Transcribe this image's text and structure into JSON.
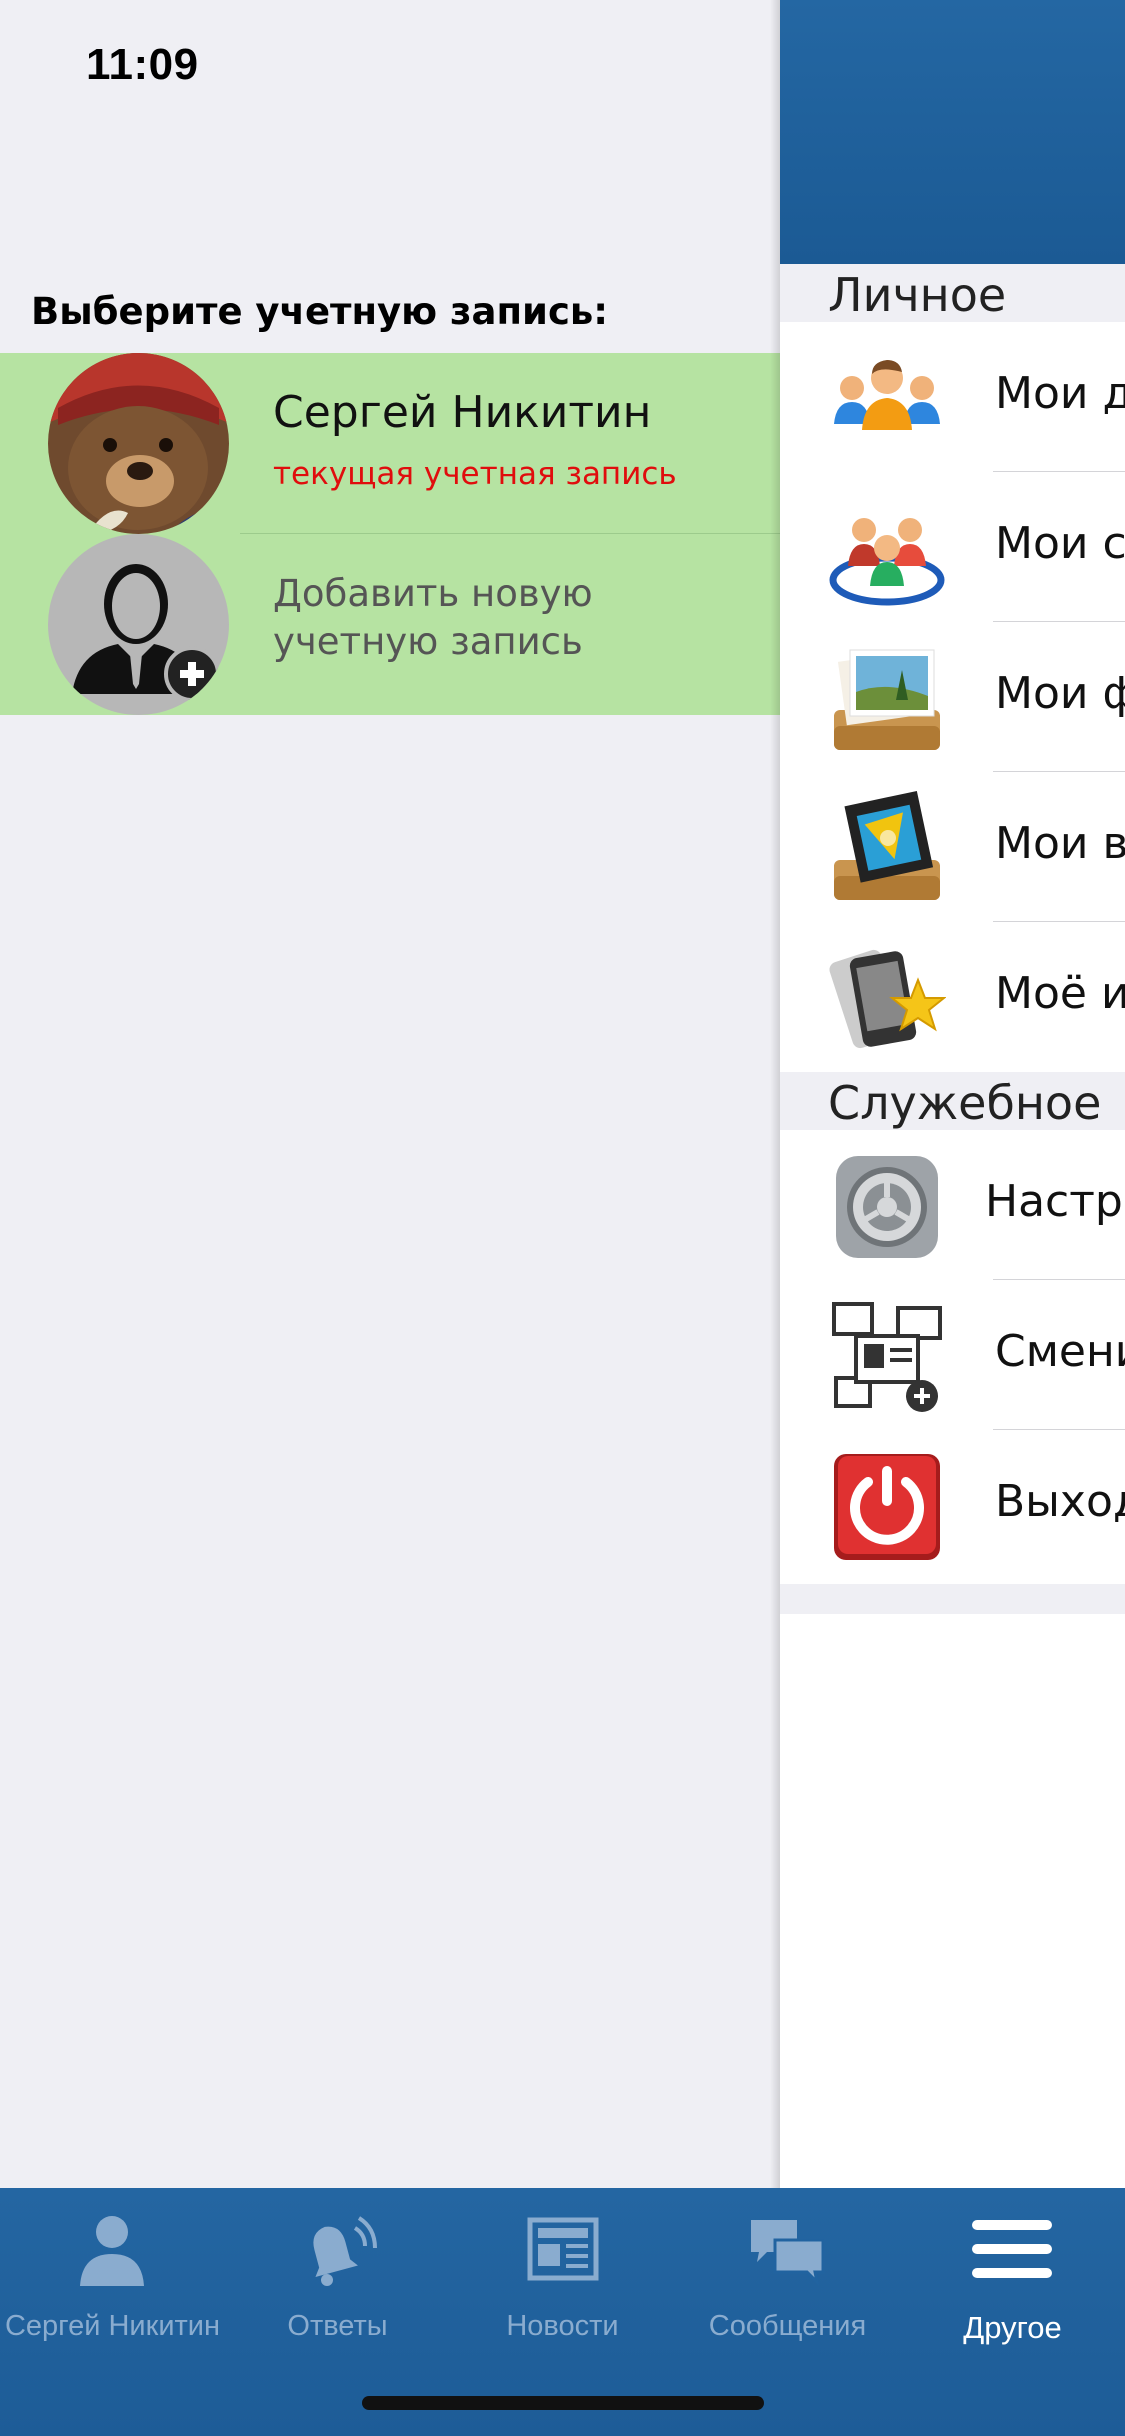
{
  "status_bar": {
    "time": "11:09",
    "icons": [
      "signal-icon",
      "wifi-icon",
      "battery-icon"
    ]
  },
  "accounts_panel": {
    "title": "Выберите учетную запись:",
    "accounts": [
      {
        "name": "Сергей Никитин",
        "subtitle": "текущая учетная запись",
        "avatar": "bear-avatar"
      }
    ],
    "add_account_label": "Добавить новую\nучетную запись",
    "colors": {
      "row_bg": "#b6e3a2",
      "current_label": "#e00d0d"
    }
  },
  "drawer": {
    "sections": [
      {
        "title": "Личное",
        "items": [
          {
            "label": "Мои д",
            "icon": "friends-icon"
          },
          {
            "label": "Мои с",
            "icon": "communities-icon"
          },
          {
            "label": "Мои ф",
            "icon": "photos-icon"
          },
          {
            "label": "Мои в",
            "icon": "videos-icon"
          },
          {
            "label": "Моё и",
            "icon": "favorites-icon"
          }
        ]
      },
      {
        "title": "Служебное",
        "items": [
          {
            "label": "Настро",
            "icon": "settings-icon"
          },
          {
            "label": "Смени",
            "icon": "switch-account-icon"
          },
          {
            "label": "Выход",
            "icon": "power-icon"
          }
        ]
      }
    ],
    "colors": {
      "header": "#1f5f9c",
      "section_bg": "#efeff4"
    }
  },
  "tabbar": {
    "tabs": [
      {
        "label": "Сергей Никитин",
        "icon": "person-icon",
        "active": false
      },
      {
        "label": "Ответы",
        "icon": "bell-icon",
        "active": false
      },
      {
        "label": "Новости",
        "icon": "newspaper-icon",
        "active": false
      },
      {
        "label": "Сообщения",
        "icon": "chat-bubbles-icon",
        "active": false
      },
      {
        "label": "Другое",
        "icon": "hamburger-menu-icon",
        "active": true
      }
    ],
    "colors": {
      "bg": "#2163a0",
      "inactive": "#8aaccf",
      "active": "#ffffff"
    }
  }
}
